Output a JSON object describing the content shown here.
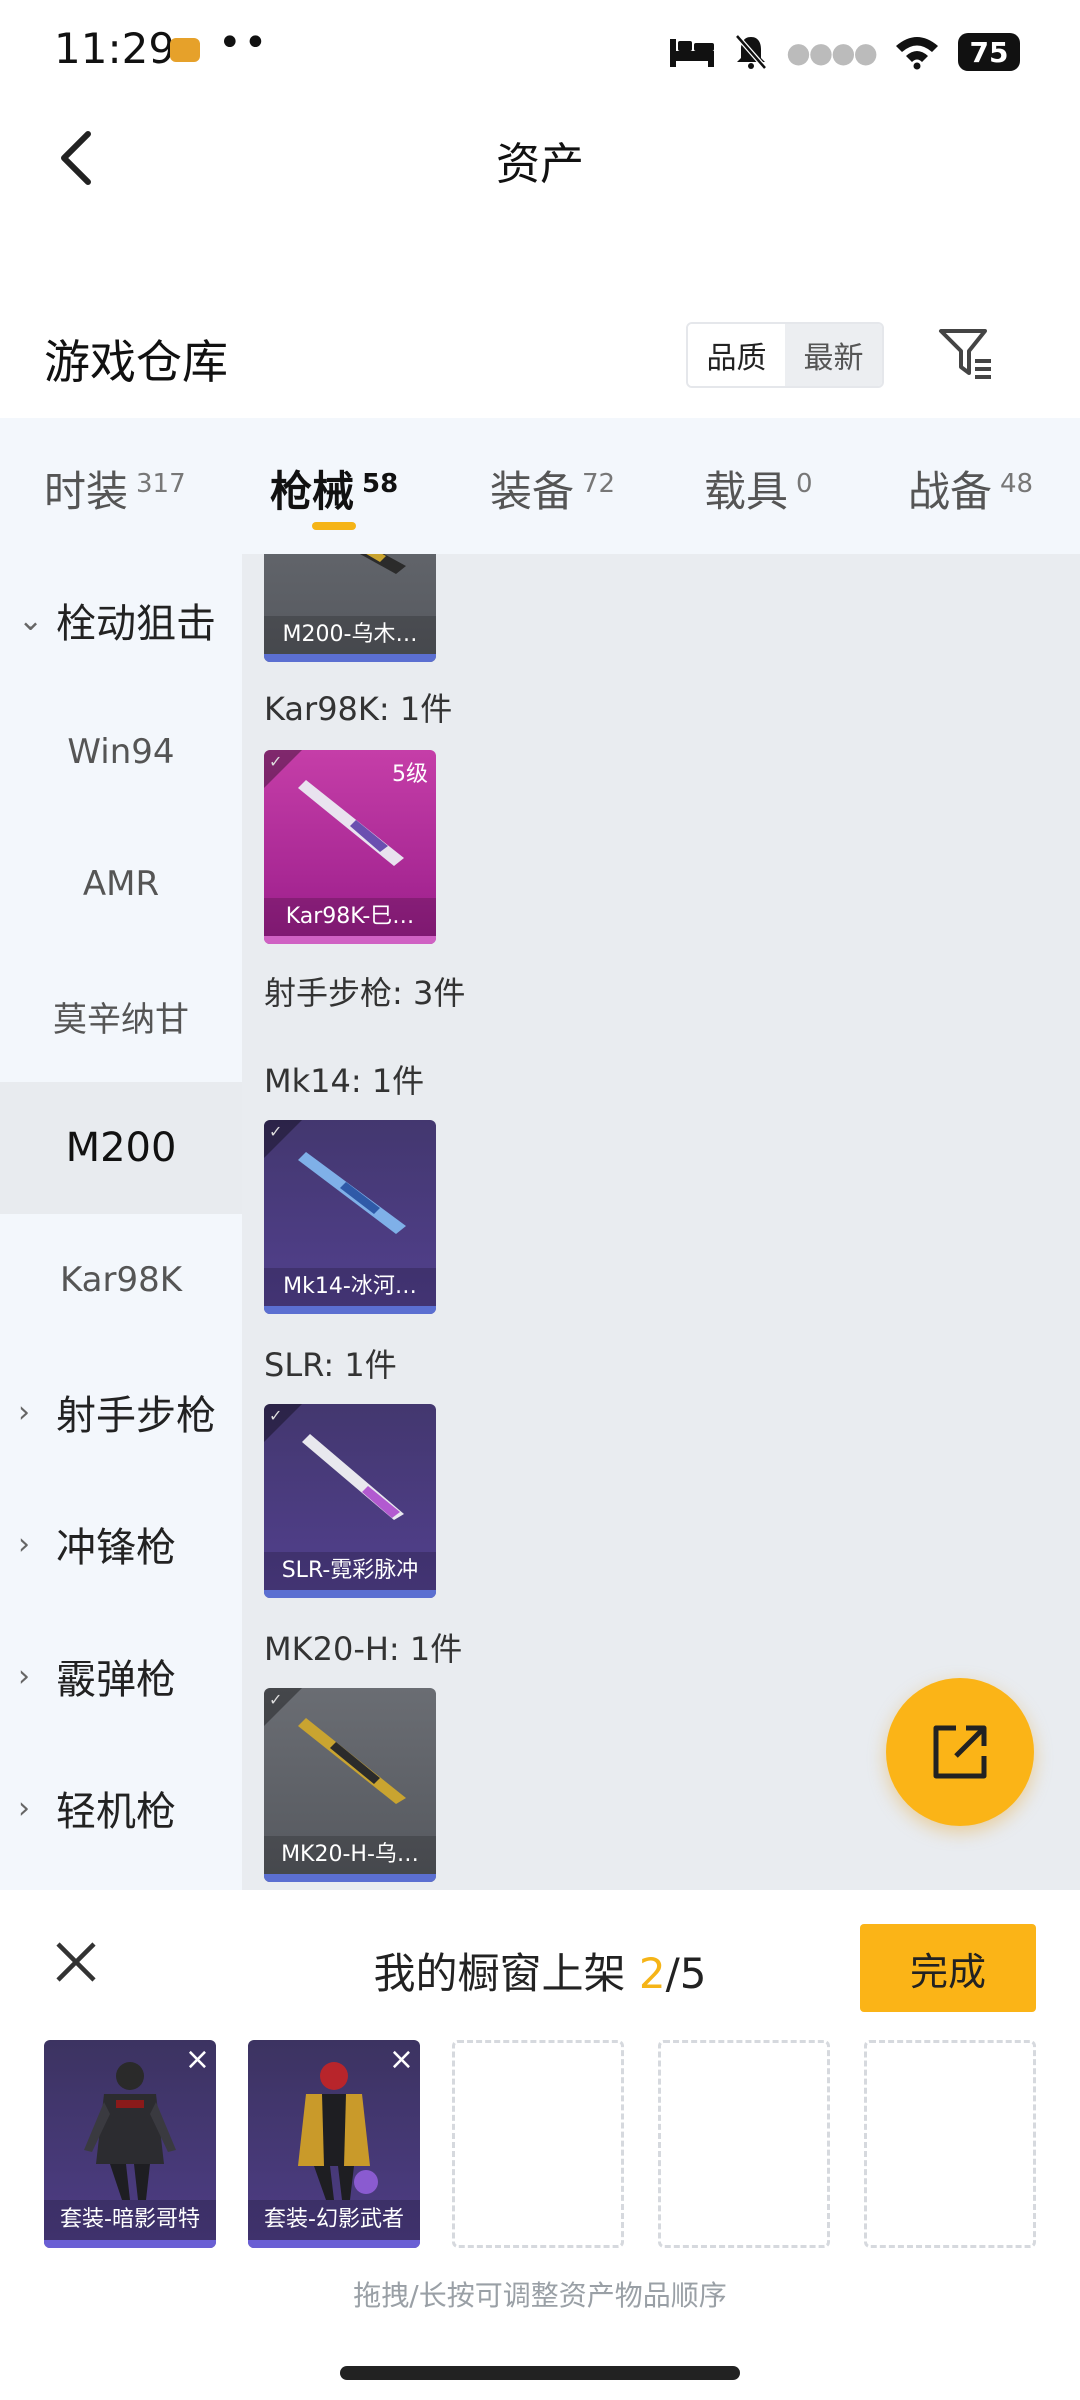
{
  "status_bar": {
    "time": "11:29",
    "dots": "••",
    "battery": "75"
  },
  "nav": {
    "title": "资产"
  },
  "warehouse": {
    "title": "游戏仓库",
    "sort_options": [
      "品质",
      "最新"
    ]
  },
  "tabs": [
    {
      "label": "时装",
      "count": "317"
    },
    {
      "label": "枪械",
      "count": "58"
    },
    {
      "label": "装备",
      "count": "72"
    },
    {
      "label": "载具",
      "count": "0"
    },
    {
      "label": "战备",
      "count": "48"
    }
  ],
  "sidebar": {
    "items": [
      "栓动狙击",
      "Win94",
      "AMR",
      "莫辛纳甘",
      "M200",
      "Kar98K",
      "射手步枪",
      "冲锋枪",
      "霰弹枪",
      "轻机枪"
    ]
  },
  "content": {
    "sections": [
      {
        "label": "Kar98K: 1件"
      },
      {
        "label": "射手步枪: 3件"
      },
      {
        "label": "Mk14: 1件"
      },
      {
        "label": "SLR: 1件"
      },
      {
        "label": "MK20-H: 1件"
      }
    ],
    "cards": [
      {
        "name": "M200-乌木…"
      },
      {
        "name": "Kar98K-巳…",
        "level": "5级"
      },
      {
        "name": "Mk14-冰河…"
      },
      {
        "name": "SLR-霓彩脉冲"
      },
      {
        "name": "MK20-H-乌…"
      }
    ]
  },
  "panel": {
    "title_prefix": "我的橱窗上架 ",
    "count": "2",
    "total": "/5",
    "done_label": "完成",
    "slots": [
      {
        "name": "套装-暗影哥特"
      },
      {
        "name": "套装-幻影武者"
      }
    ],
    "hint": "拖拽/长按可调整资产物品顺序"
  },
  "colors": {
    "accent": "#fbb417",
    "sidebar_bg": "#f3f7fc",
    "content_bg": "#e9ecf0"
  }
}
